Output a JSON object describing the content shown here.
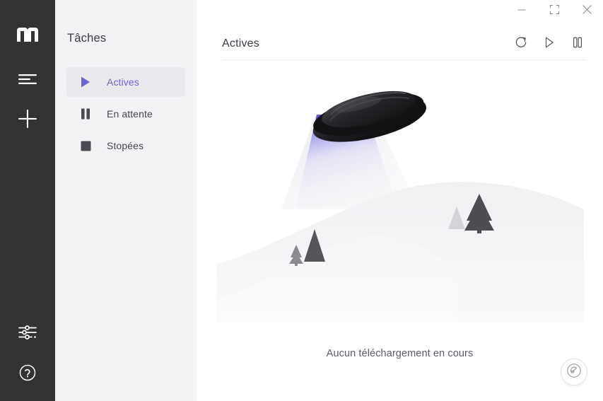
{
  "window": {
    "controls": [
      {
        "name": "minimize",
        "glyph": "minimize-icon"
      },
      {
        "name": "maximize",
        "glyph": "maximize-icon"
      },
      {
        "name": "close",
        "glyph": "close-icon"
      }
    ]
  },
  "rail": {
    "logo": "motrix-logo",
    "items": [
      {
        "name": "task-list",
        "icon": "list-icon"
      },
      {
        "name": "add-task",
        "icon": "plus-icon"
      },
      {
        "name": "preferences",
        "icon": "sliders-icon"
      },
      {
        "name": "help",
        "icon": "question-circle-icon"
      }
    ]
  },
  "sidebar": {
    "title": "Tâches",
    "items": [
      {
        "label": "Actives",
        "icon": "play-icon",
        "active": true
      },
      {
        "label": "En attente",
        "icon": "pause-icon",
        "active": false
      },
      {
        "label": "Stopées",
        "icon": "stop-icon",
        "active": false
      }
    ]
  },
  "main": {
    "title": "Actives",
    "actions": [
      {
        "name": "refresh",
        "icon": "refresh-icon"
      },
      {
        "name": "resume-all",
        "icon": "play-outline-icon"
      },
      {
        "name": "pause-all",
        "icon": "pause-icon"
      }
    ],
    "empty_message": "Aucun téléchargement en cours",
    "illustration": "ufo-over-hills",
    "speed_button": "speedometer-icon"
  },
  "colors": {
    "rail_bg": "#333336",
    "panel_bg": "#f3f3f5",
    "content_bg": "#ffffff",
    "accent": "#6c63d6",
    "active_item_bg": "#eaeaee",
    "text_primary": "#3c3c46",
    "text_secondary": "#5c5c66",
    "beam_top": "#6a5fe0",
    "tree_dark": "#55555c",
    "tree_light": "#d4d4d8"
  }
}
